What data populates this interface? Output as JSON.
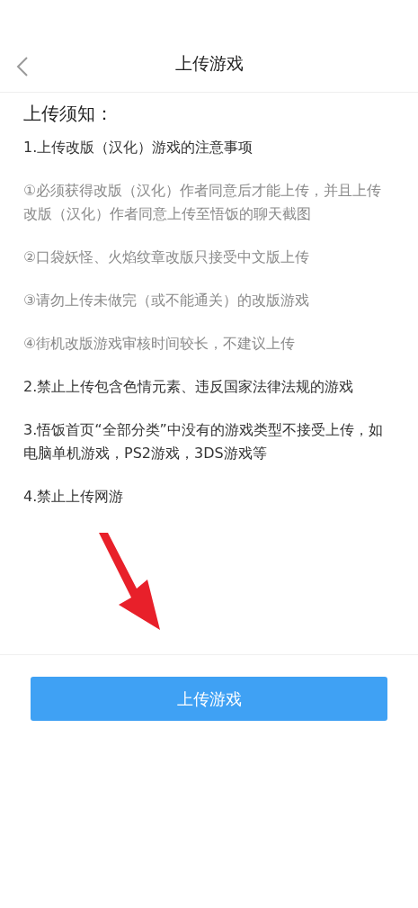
{
  "header": {
    "title": "上传游戏"
  },
  "notice": {
    "heading": "上传须知：",
    "items": [
      {
        "kind": "main",
        "text": "1.上传改版（汉化）游戏的注意事项"
      },
      {
        "kind": "sub",
        "text": "①必须获得改版（汉化）作者同意后才能上传，并且上传改版（汉化）作者同意上传至悟饭的聊天截图"
      },
      {
        "kind": "sub",
        "text": "②口袋妖怪、火焰纹章改版只接受中文版上传"
      },
      {
        "kind": "sub",
        "text": "③请勿上传未做完（或不能通关）的改版游戏"
      },
      {
        "kind": "sub",
        "text": "④街机改版游戏审核时间较长，不建议上传"
      },
      {
        "kind": "main",
        "text": "2.禁止上传包含色情元素、违反国家法律法规的游戏"
      },
      {
        "kind": "main",
        "text": "3.悟饭首页“全部分类”中没有的游戏类型不接受上传，如电脑单机游戏，PS2游戏，3DS游戏等"
      },
      {
        "kind": "main",
        "text": "4.禁止上传网游"
      }
    ]
  },
  "button": {
    "label": "上传游戏"
  }
}
